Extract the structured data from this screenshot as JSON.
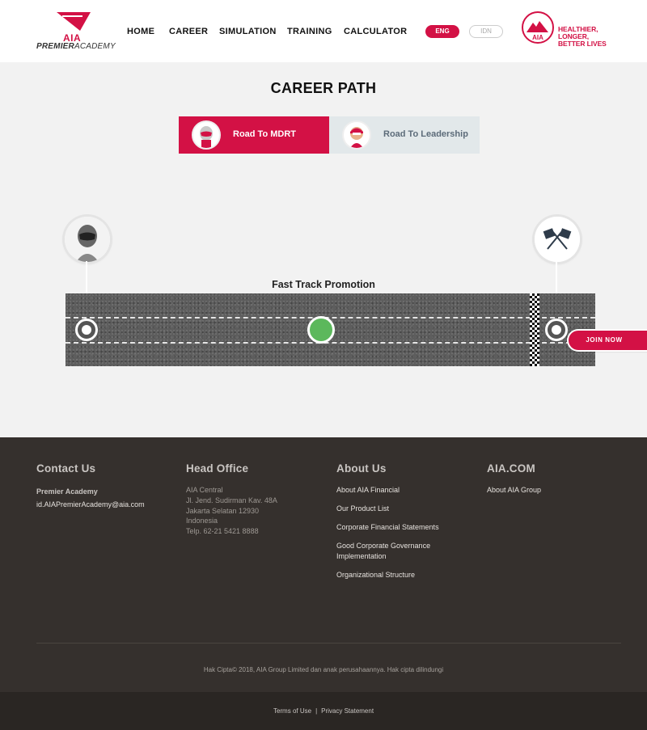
{
  "header": {
    "logo": {
      "brand": "AIA",
      "sub_bold": "PREMIER",
      "sub_light": "ACADEMY"
    },
    "nav": [
      "HOME",
      "CAREER",
      "SIMULATION",
      "TRAINING",
      "CALCULATOR"
    ],
    "languages": {
      "active": "ENG",
      "inactive": "IDN"
    },
    "tagline_line1": "HEALTHIER, LONGER,",
    "tagline_line2": "BETTER LIVES"
  },
  "career": {
    "title": "CAREER PATH",
    "tabs": [
      {
        "label": "Road To MDRT",
        "active": true
      },
      {
        "label": "Road To Leadership",
        "active": false
      }
    ],
    "track_title": "Fast Track Promotion",
    "progress_fraction": 0.49,
    "join_label": "JOIN NOW"
  },
  "footer": {
    "contact": {
      "heading": "Contact Us",
      "name": "Premier Academy",
      "email": "id.AIAPremierAcademy@aia.com"
    },
    "office": {
      "heading": "Head Office",
      "lines": [
        "AIA Central",
        "Jl. Jend. Sudirman Kav. 48A",
        "Jakarta Selatan 12930",
        "Indonesia",
        "Telp. 62-21 5421 8888"
      ]
    },
    "about": {
      "heading": "About Us",
      "links": [
        "About AIA Financial",
        "Our Product List",
        "Corporate Financial Statements",
        "Good Corporate Governance Implementation",
        "Organizational Structure"
      ]
    },
    "aia": {
      "heading": "AIA.COM",
      "links": [
        "About AIA Group"
      ]
    },
    "copyright": "Hak Cipta© 2018, AIA Group Limited dan anak perusahaannya. Hak cipta dilindungi",
    "bottom_links": [
      "Terms of Use",
      "Privacy Statement"
    ]
  },
  "colors": {
    "accent": "#d31145",
    "progress": "#5cb85c",
    "footer": "#35302d"
  }
}
